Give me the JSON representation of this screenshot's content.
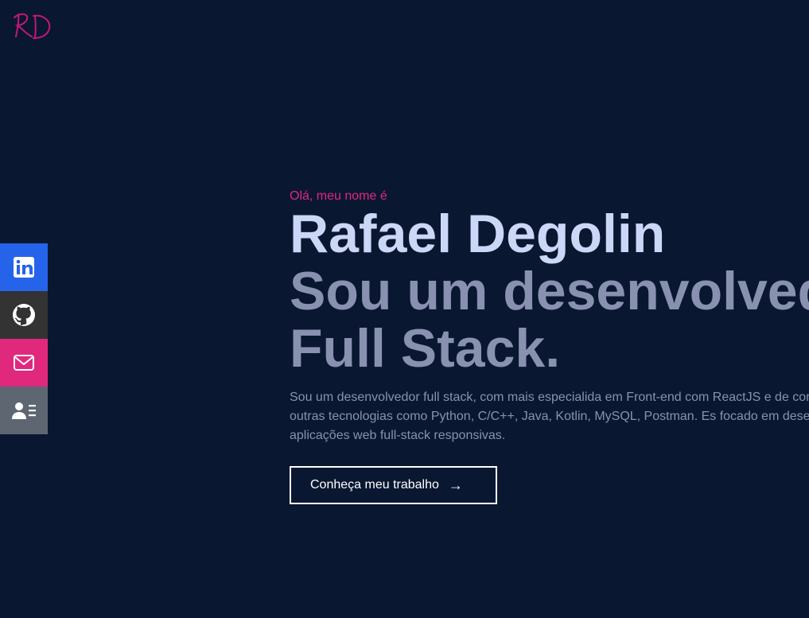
{
  "logo": {
    "text": "RD",
    "color": "#c2187a"
  },
  "social": [
    {
      "name": "linkedin",
      "icon": "linkedin-icon",
      "color": "#2563eb"
    },
    {
      "name": "github",
      "icon": "github-icon",
      "color": "#333333"
    },
    {
      "name": "email",
      "icon": "envelope-icon",
      "color": "#e0287d"
    },
    {
      "name": "resume",
      "icon": "contact-card-icon",
      "color": "#5e6672"
    }
  ],
  "hero": {
    "greeting": "Olá, meu nome é",
    "name": "Rafael Degolin",
    "tagline": "Sou um desenvolvedor Full Stack.",
    "description": "Sou um desenvolvedor full stack, com mais especialida em Front-end com ReactJS e de conhecedor de outras tecnologias como Python, C/C++, Java, Kotlin, MySQL, Postman. Es focado em desenvolver aplicações web full-stack responsivas.",
    "cta_label": "Conheça meu trabalho",
    "cta_arrow": "→"
  },
  "colors": {
    "background": "#0a1731",
    "greeting": "#e0287d",
    "name": "#ccd6f6",
    "muted": "#8892b0"
  }
}
